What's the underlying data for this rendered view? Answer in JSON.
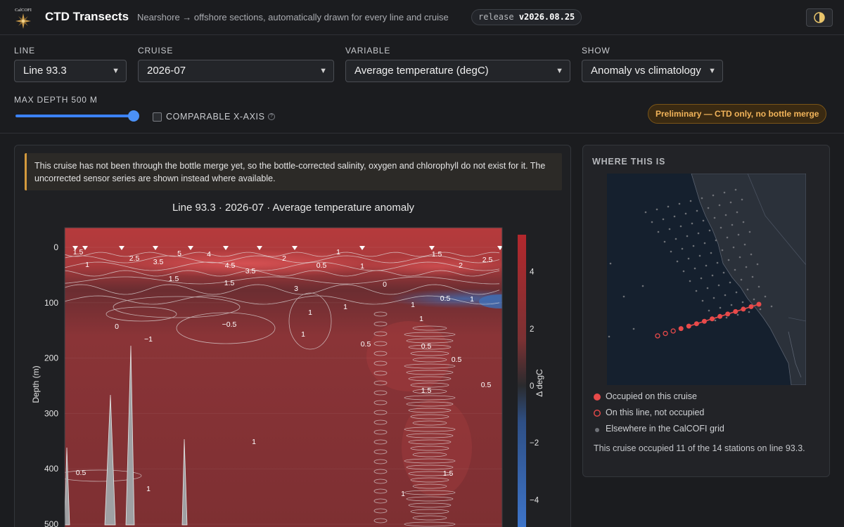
{
  "header": {
    "logo_text": "CalCOFI",
    "title": "CTD Transects",
    "subtitle": "Nearshore → offshore sections, automatically drawn for every line and cruise",
    "release_prefix": "release",
    "release_version": "v2026.08.25"
  },
  "controls": {
    "line": {
      "label": "LINE",
      "value": "Line 93.3"
    },
    "cruise": {
      "label": "CRUISE",
      "value": "2026-07"
    },
    "variable": {
      "label": "VARIABLE",
      "value": "Average temperature (degC)"
    },
    "show": {
      "label": "SHOW",
      "value": "Anomaly vs climatology"
    },
    "max_depth": {
      "label": "MAX DEPTH 500 M",
      "value_m": 500
    },
    "comparable_x": {
      "label": "COMPARABLE X-AXIS",
      "checked": false,
      "help": "?"
    },
    "status_badge": "Preliminary — CTD only, no bottle merge"
  },
  "notice": "This cruise has not been through the bottle merge yet, so the bottle-corrected salinity, oxygen and chlorophyll do not exist for it. The uncorrected sensor series are shown instead where available.",
  "chart_data": {
    "type": "heatmap",
    "title": "Line 93.3 · 2026-07 · Average temperature anomaly",
    "ylabel": "Depth (m)",
    "colorbar_label": "Δ degC",
    "ylim": [
      500,
      0
    ],
    "yticks": [
      "0",
      "100",
      "200",
      "300",
      "400",
      "500"
    ],
    "colorbar_ticks": [
      "4",
      "2",
      "0",
      "−2",
      "−4"
    ],
    "clim": [
      -5.3,
      5.3
    ],
    "station_markers": 14,
    "contour_labels": [
      "1.5",
      "1",
      "2.5",
      "3.5",
      "5",
      "4",
      "4.5",
      "3.5",
      "2",
      "1.5",
      "1.5",
      "1",
      "0.5",
      "1",
      "1.5",
      "2",
      "2.5",
      "3",
      "0",
      "0.5",
      "1",
      "0",
      "−0.5",
      "−1",
      "1",
      "1",
      "0.5",
      "0.5",
      "0.5",
      "0.5",
      "1.5",
      "1",
      "0.5",
      "1.5",
      "1",
      "1",
      "1",
      "1",
      "1"
    ],
    "colors": {
      "warm": "#b83436",
      "cool": "#3d6fb8",
      "neutral": "#2a2b2e",
      "contour": "#e6e6e6"
    }
  },
  "side": {
    "title": "WHERE THIS IS",
    "legend": [
      {
        "label": "Occupied on this cruise",
        "color": "#e84a4a"
      },
      {
        "label": "On this line, not occupied",
        "color": "#e84a4a"
      },
      {
        "label": "Elsewhere in the CalCOFI grid",
        "color": "#6e7177"
      }
    ],
    "note": "This cruise occupied 11 of the 14 stations on line 93.3.",
    "stations_occupied": 11,
    "stations_total": 14
  }
}
